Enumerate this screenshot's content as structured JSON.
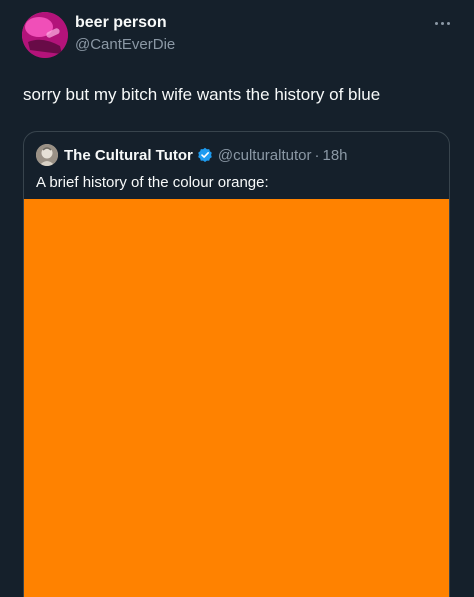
{
  "tweet": {
    "author": {
      "display_name": "beer person",
      "handle": "@CantEverDie",
      "avatar_icon": "avatar-pink-photo"
    },
    "more_icon": "more-horizontal-icon",
    "text": "sorry but my bitch wife wants the history of blue"
  },
  "quoted_tweet": {
    "author": {
      "display_name": "The Cultural Tutor",
      "handle": "@culturaltutor",
      "avatar_icon": "avatar-statue-bust",
      "verified_icon": "verified-badge-icon"
    },
    "separator": "·",
    "time": "18h",
    "text": "A brief history of the colour orange:",
    "media": {
      "color": "#ff8200"
    }
  },
  "colors": {
    "background": "#15202b",
    "border": "#38444d",
    "secondary_text": "#8b98a5",
    "verified_blue": "#1d9bf0",
    "media_orange": "#ff8200"
  }
}
